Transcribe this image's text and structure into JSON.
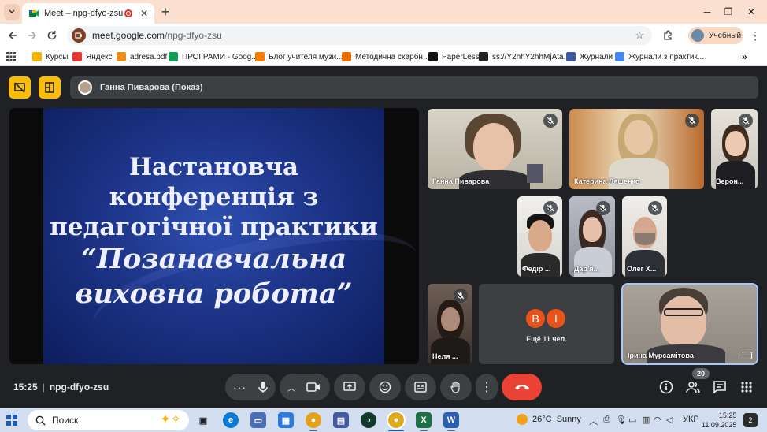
{
  "browser": {
    "tab_title": "Meet – npg-dfyo-zsu",
    "url_host": "meet.google.com",
    "url_path": "/npg-dfyo-zsu",
    "profile_name": "Учебный",
    "bookmarks": [
      {
        "label": "Курсы",
        "color": "#f4b400"
      },
      {
        "label": "Яндекс",
        "color": "#e53935"
      },
      {
        "label": "adresa.pdf",
        "color": "#e88d1c"
      },
      {
        "label": "ПРОГРАМИ - Goog...",
        "color": "#0f9d58"
      },
      {
        "label": "Блог учителя музи...",
        "color": "#f57c00"
      },
      {
        "label": "Методична скарбн...",
        "color": "#ef6c00"
      },
      {
        "label": "PaperLess",
        "color": "#111111"
      },
      {
        "label": "ss://Y2hhY2hhMjAta...",
        "color": "#222222"
      },
      {
        "label": "Журнали",
        "color": "#3b5ba5"
      },
      {
        "label": "Журнали з практик...",
        "color": "#4285f4"
      }
    ]
  },
  "meet": {
    "presenter_label": "Ганна Пиварова (Показ)",
    "slide_lines": [
      "Настановча",
      "конференція з",
      "педагогічної практики",
      "“Позанавчальна",
      "виховна робота”"
    ],
    "participants": [
      {
        "name": "Ганна Пиварова"
      },
      {
        "name": "Катерина Ляшенко"
      },
      {
        "name": "Верон..."
      },
      {
        "name": "Федір ..."
      },
      {
        "name": "Дар’я..."
      },
      {
        "name": "Олег Х..."
      },
      {
        "name": "Неля ..."
      },
      {
        "name": "Ірина Мурсамітова"
      }
    ],
    "others_initials": [
      "В",
      "І"
    ],
    "others_colors": [
      "#e8521b",
      "#e8521b"
    ],
    "others_label": "Ещё 11 чел.",
    "time": "15:25",
    "meeting_code": "npg-dfyo-zsu",
    "participant_count": "20",
    "accent": "#fbbc04",
    "end_call_color": "#ea4335"
  },
  "taskbar": {
    "search_label": "Поиск",
    "temperature": "26°C",
    "weather": "Sunny",
    "language": "УКР",
    "time": "15:25",
    "date": "11.09.2025",
    "notifications": "2"
  }
}
